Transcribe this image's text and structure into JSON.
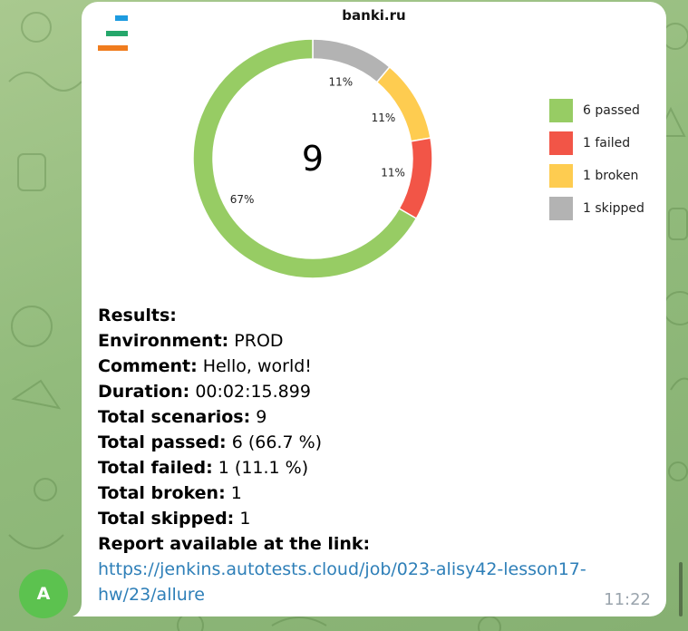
{
  "chat": {
    "sender_avatar_letter": "A",
    "avatar_color": "#5cc24f",
    "message_time": "11:22"
  },
  "report_image": {
    "title": "banki.ru",
    "logo_colors": [
      "#1d9be0",
      "#25a76b",
      "#f07c1e"
    ]
  },
  "chart_data": {
    "type": "pie",
    "style": "donut",
    "title": "banki.ru",
    "center_label": "9",
    "total": 9,
    "slices": [
      {
        "name": "skipped",
        "value": 1,
        "percent_label": "11%",
        "color": "#b3b3b3"
      },
      {
        "name": "broken",
        "value": 1,
        "percent_label": "11%",
        "color": "#fecc50"
      },
      {
        "name": "failed",
        "value": 1,
        "percent_label": "11%",
        "color": "#f25547"
      },
      {
        "name": "passed",
        "value": 6,
        "percent_label": "67%",
        "color": "#97cc64"
      }
    ],
    "legend": [
      {
        "label": "6 passed",
        "color": "#97cc64"
      },
      {
        "label": "1 failed",
        "color": "#f25547"
      },
      {
        "label": "1 broken",
        "color": "#fecc50"
      },
      {
        "label": "1 skipped",
        "color": "#b3b3b3"
      }
    ],
    "legend_position": "right"
  },
  "results": {
    "heading": "Results:",
    "environment_label": "Environment:",
    "environment_value": "PROD",
    "comment_label": "Comment:",
    "comment_value": "Hello, world!",
    "duration_label": "Duration:",
    "duration_value": "00:02:15.899",
    "scenarios_label": "Total scenarios:",
    "scenarios_value": "9",
    "passed_label": "Total passed:",
    "passed_value": "6 (66.7 %)",
    "failed_label": "Total failed:",
    "failed_value": "1 (11.1 %)",
    "broken_label": "Total broken:",
    "broken_value": "1",
    "skipped_label": "Total skipped:",
    "skipped_value": "1",
    "report_label": "Report available at the link:",
    "report_link_line1": "https://jenkins.autotests.cloud/job/023-alisy42-lesson17-",
    "report_link_line2": "hw/23/allure"
  }
}
